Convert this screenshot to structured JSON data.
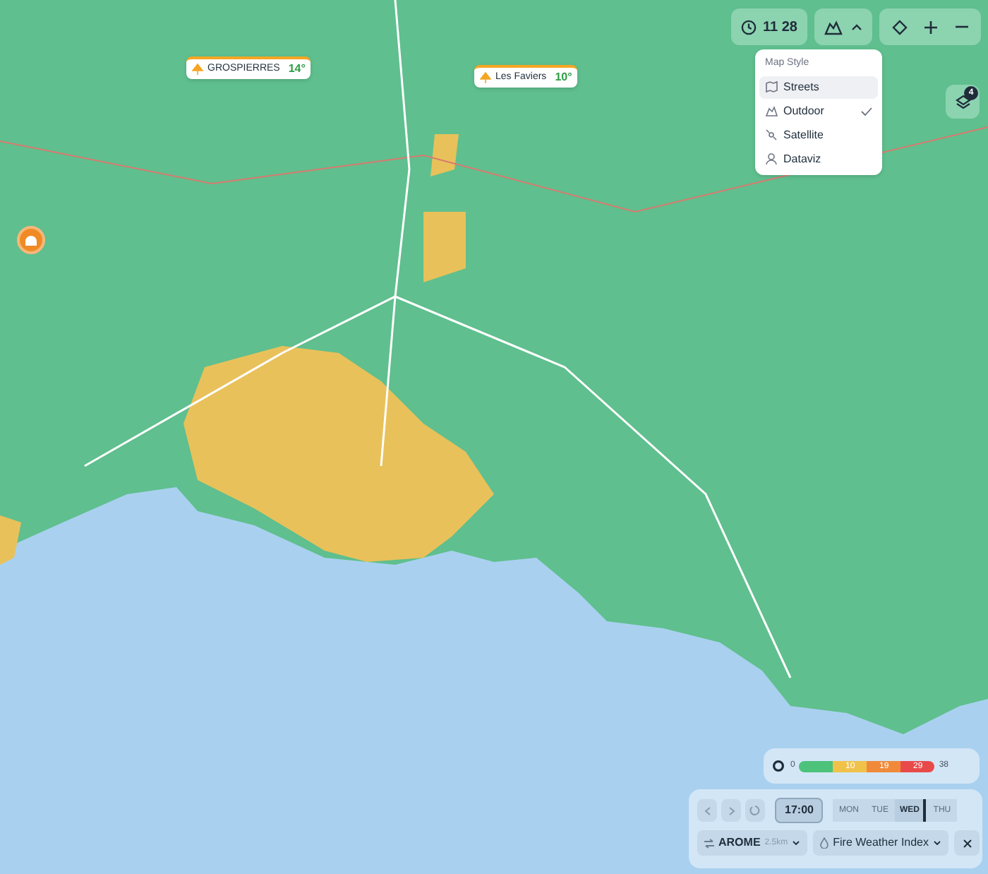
{
  "stations": [
    {
      "name": "GROSPIERRES",
      "temp": "14°"
    },
    {
      "name": "Les Faviers",
      "temp": "10°"
    }
  ],
  "top_controls": {
    "time": "11 28"
  },
  "map_style": {
    "title": "Map Style",
    "items": [
      {
        "label": "Streets",
        "highlighted": true,
        "checked": false
      },
      {
        "label": "Outdoor",
        "highlighted": false,
        "checked": true
      },
      {
        "label": "Satellite",
        "highlighted": false,
        "checked": false
      },
      {
        "label": "Dataviz",
        "highlighted": false,
        "checked": false
      }
    ]
  },
  "layers": {
    "badge": "4"
  },
  "legend": {
    "min": "0",
    "segment_labels": [
      "10",
      "19",
      "29"
    ],
    "max": "38"
  },
  "timeline": {
    "time": "17:00",
    "days": [
      {
        "label": "MON",
        "selected": false
      },
      {
        "label": "TUE",
        "selected": false
      },
      {
        "label": "WED",
        "selected": true
      },
      {
        "label": "THU",
        "selected": false
      }
    ]
  },
  "model": {
    "name": "AROME",
    "resolution": "2.5km"
  },
  "index": {
    "label": "Fire Weather Index"
  }
}
